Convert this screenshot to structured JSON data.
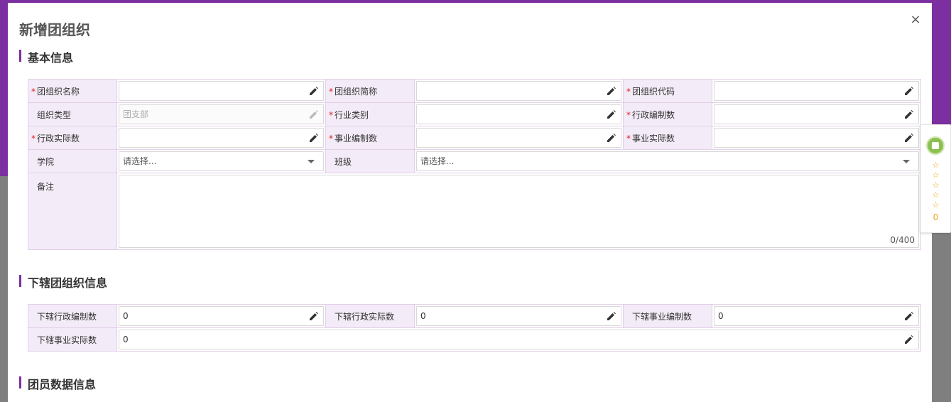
{
  "dialog": {
    "title": "新增团组织",
    "close_label": "×"
  },
  "basic": {
    "title": "基本信息",
    "org_name_label": "团组织名称",
    "org_short_label": "团组织简称",
    "org_code_label": "团组织代码",
    "org_type_label": "组织类型",
    "org_type_value": "团支部",
    "industry_label": "行业类别",
    "admin_quota_label": "行政编制数",
    "admin_actual_label": "行政实际数",
    "career_quota_label": "事业编制数",
    "career_actual_label": "事业实际数",
    "college_label": "学院",
    "college_placeholder": "请选择...",
    "class_label": "班级",
    "class_placeholder": "请选择...",
    "remark_label": "备注",
    "remark_counter": "0/400"
  },
  "subordinate": {
    "title": "下辖团组织信息",
    "sub_admin_quota_label": "下辖行政编制数",
    "sub_admin_quota_value": "0",
    "sub_admin_actual_label": "下辖行政实际数",
    "sub_admin_actual_value": "0",
    "sub_career_quota_label": "下辖事业编制数",
    "sub_career_quota_value": "0",
    "sub_career_actual_label": "下辖事业实际数",
    "sub_career_actual_value": "0"
  },
  "members": {
    "title": "团员数据信息"
  },
  "widget": {
    "stars": "☆☆☆☆☆",
    "count": "0"
  },
  "colors": {
    "accent": "#7b2fa0",
    "label_bg": "#f3ebf7",
    "required": "#e02020",
    "star": "#e8a317"
  },
  "icons": {
    "edit": "pencil-icon",
    "dropdown": "caret-down-icon",
    "close": "close-icon"
  }
}
